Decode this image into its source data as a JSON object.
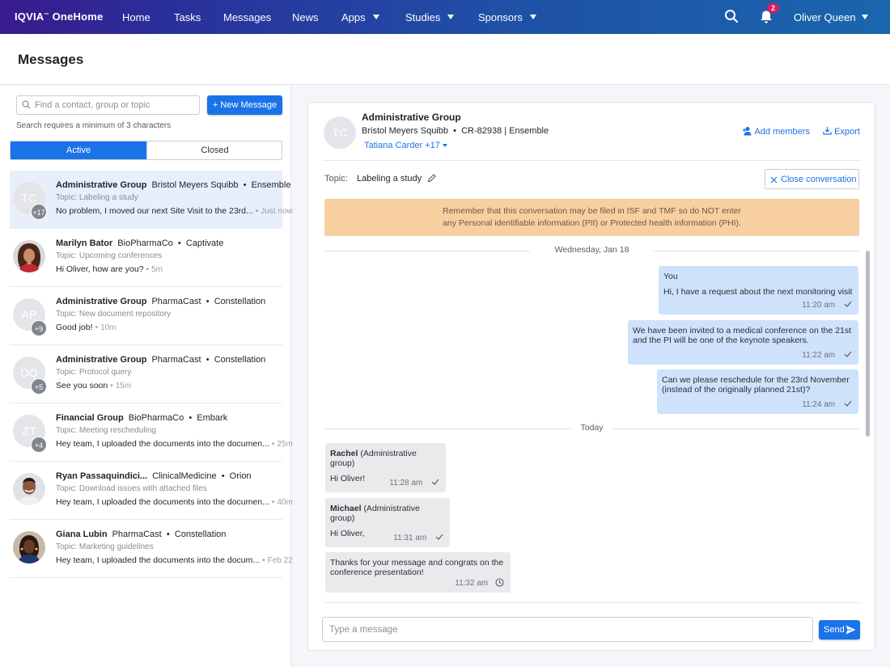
{
  "nav": {
    "brand": "IQVIA",
    "brand_mark": "™",
    "product": "OneHome",
    "items": [
      {
        "label": "Home",
        "dropdown": false
      },
      {
        "label": "Tasks",
        "dropdown": false
      },
      {
        "label": "Messages",
        "dropdown": false
      },
      {
        "label": "News",
        "dropdown": false
      },
      {
        "label": "Apps",
        "dropdown": true
      },
      {
        "label": "Studies",
        "dropdown": true
      },
      {
        "label": "Sponsors",
        "dropdown": true
      }
    ],
    "notification_count": "2",
    "user_name": "Oliver Queen"
  },
  "page": {
    "title": "Messages"
  },
  "sidebar": {
    "search_placeholder": "Find a contact, group or topic",
    "new_message_label": "New Message",
    "search_hint": "Search requires a minimum of 3 characters",
    "tabs": [
      {
        "label": "Active",
        "active": true
      },
      {
        "label": "Closed",
        "active": false
      }
    ],
    "conversations": [
      {
        "name": "Administrative Group",
        "org": "Bristol Meyers Squibb",
        "product": "Ensemble",
        "topic": "Topic: Labeling a study",
        "preview": "No problem, I moved our next Site Visit to the 23rd...",
        "time": "Just now",
        "initials": "TC",
        "count": "+17",
        "selected": true
      },
      {
        "name": "Marilyn Bator",
        "org": "BioPharmaCo",
        "product": "Captivate",
        "topic": "Topic: Upcoming conferences",
        "preview": "Hi Oliver, how are you?",
        "time": "5m",
        "photo": "woman-red"
      },
      {
        "name": "Administrative Group",
        "org": "PharmaCast",
        "product": "Constellation",
        "topic": "Topic: New document repository",
        "preview": "Good job!",
        "time": "10m",
        "initials": "AP",
        "count": "+9"
      },
      {
        "name": "Administrative Group",
        "org": "PharmaCast",
        "product": "Constellation",
        "topic": "Topic: Protocol query",
        "preview": "See you soon",
        "time": "15m",
        "initials": "OQ",
        "count": "+5"
      },
      {
        "name": "Financial Group",
        "org": "BioPharmaCo",
        "product": "Embark",
        "topic": "Topic: Meeting rescheduling",
        "preview": "Hey team, I uploaded the documents into the documen...",
        "time": "25m",
        "initials": "ZT",
        "count": "+4"
      },
      {
        "name": "Ryan Passaquindici...",
        "org": "ClinicalMedicine",
        "product": "Orion",
        "topic": "Topic: Download issues with attached files",
        "preview": "Hey team, I uploaded the documents into the documen...",
        "time": "40m",
        "photo": "man-smile"
      },
      {
        "name": "Giana Lubin",
        "org": "PharmaCast",
        "product": "Constellation",
        "topic": "Topic: Marketing guidelines",
        "preview": "Hey team, I uploaded the documents into the docum...",
        "time": "Feb 22",
        "photo": "woman-dark"
      }
    ]
  },
  "conversation": {
    "initials": "TC",
    "title": "Administrative Group",
    "org": "Bristol Meyers Squibb",
    "study": "CR-82938",
    "product": "Ensemble",
    "members": "Tatiana Carder +17",
    "add_members_label": "Add members",
    "export_label": "Export",
    "topic_label": "Topic:",
    "topic_value": "Labeling a study",
    "close_label": "Close conversation",
    "warning_line1": "Remember that this conversation may be filed in ISF and TMF so do NOT enter",
    "warning_line2": "any Personal identifiable information (PII) or Protected health information (PHI).",
    "day1": "Wednesday, Jan 18",
    "day2": "Today",
    "messages": [
      {
        "sender": "You",
        "text": "Hi, I have a request about the next monitoring visit",
        "time": "11:20 am",
        "status": "sent"
      },
      {
        "text_line1": "We have been invited to a medical conference on the 21st",
        "text_line2": "and the PI will be one of the keynote speakers.",
        "time": "11:22 am",
        "status": "sent"
      },
      {
        "text_line1": "Can we please reschedule for the 23rd November",
        "text_line2": "(instead of the originally planned 21st)?",
        "time": "11:24 am",
        "status": "sent"
      },
      {
        "sender": "Rachel",
        "sender_group": "(Administrative group)",
        "text": "Hi Oliver!",
        "time": "11:28 am",
        "status": "sent"
      },
      {
        "sender": "Michael",
        "sender_group": "(Administrative group)",
        "text": "Hi Oliver,",
        "time": "11:31 am",
        "status": "sent"
      },
      {
        "text_line1": "Thanks for your message and congrats on the",
        "text_line2": "conference presentation!",
        "time": "11:32 am",
        "status": "pending"
      }
    ],
    "composer_placeholder": "Type a message",
    "send_label": "Send"
  },
  "colors": {
    "accent": "#1a73e8",
    "warning_bg": "#f8cfa0",
    "outgoing_bubble": "#cfe2fb",
    "incoming_bubble": "#e9eaec",
    "badge": "#d81b60"
  },
  "icons": [
    "search-icon",
    "bell-icon",
    "chevron-down-icon",
    "add-members-icon",
    "export-icon",
    "edit-icon",
    "close-icon",
    "check-icon",
    "clock-icon",
    "send-icon"
  ]
}
